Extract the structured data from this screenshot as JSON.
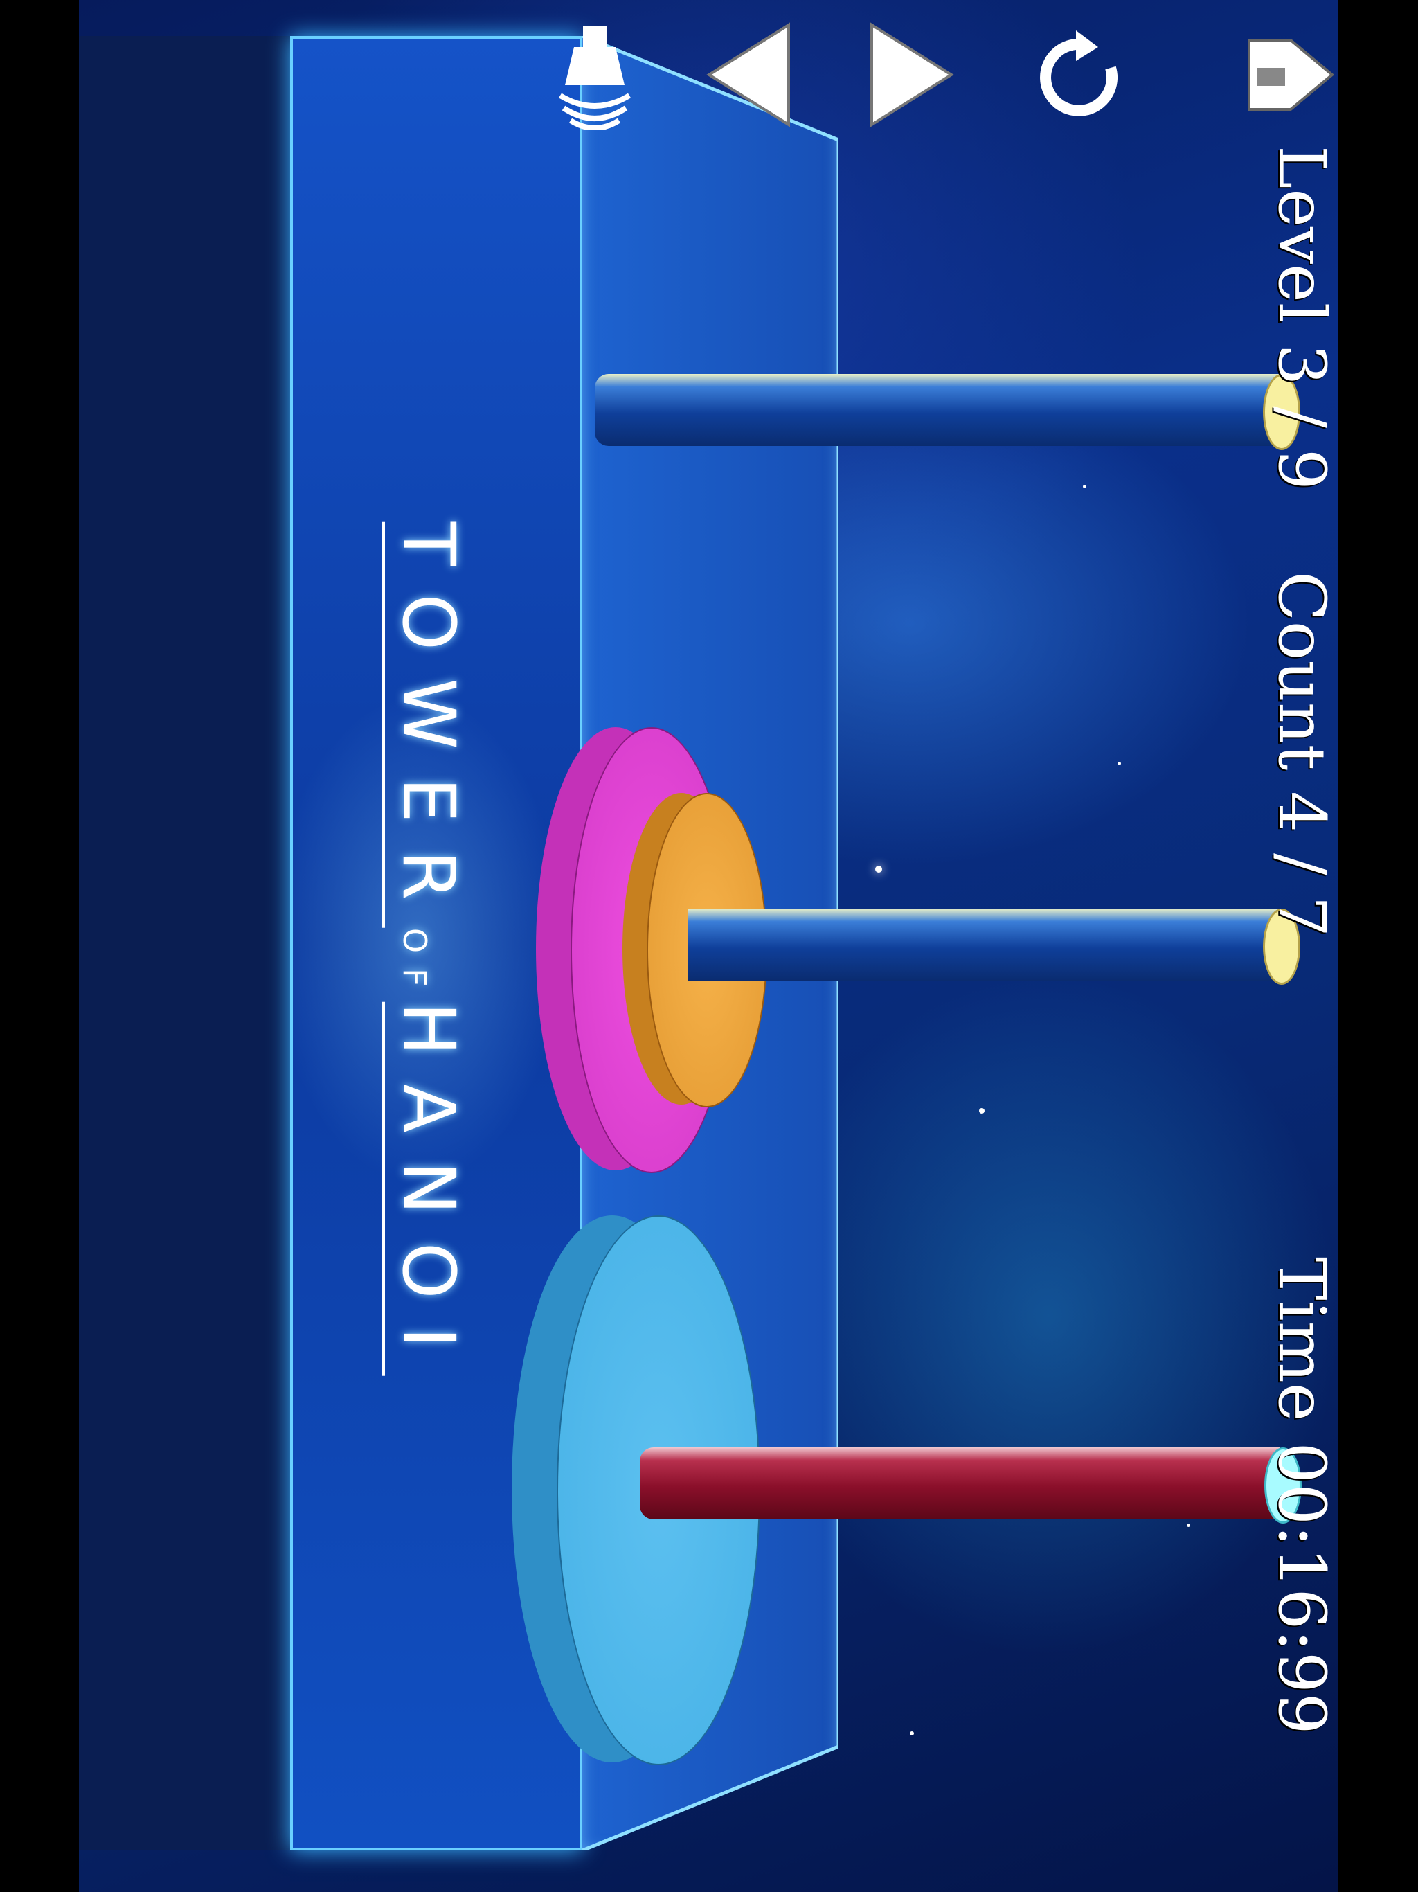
{
  "game": {
    "title_part1": "TOWER",
    "title_of": "OF",
    "title_part2": "HANOI",
    "hud": {
      "level_label": "Level",
      "level_value": "3 / 9",
      "count_label": "Count",
      "count_value": "4 / 7",
      "time_label": "Time",
      "time_value": "00:16:99"
    },
    "toolbar": {
      "sound_icon": "sound-icon",
      "prev_icon": "previous-icon",
      "next_icon": "next-icon",
      "restart_icon": "restart-icon",
      "home_icon": "home-icon"
    },
    "colors": {
      "peg_blue": "#1a56b8",
      "peg_red": "#8a0f2a",
      "disk_small": "#f0a43c",
      "disk_medium": "#e23fd6",
      "disk_large": "#46b1e6"
    }
  }
}
